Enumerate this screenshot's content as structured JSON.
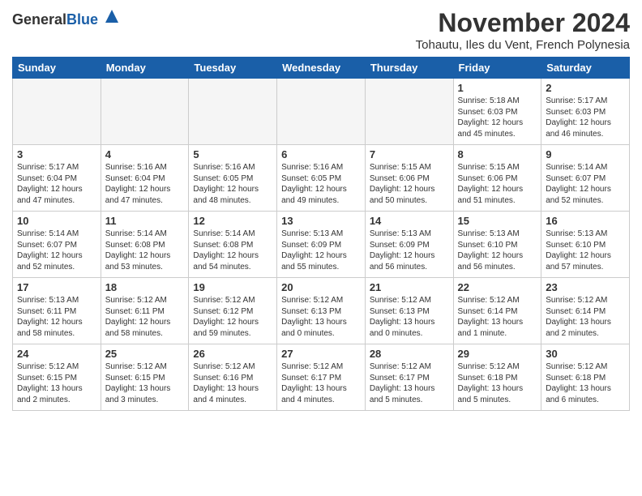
{
  "header": {
    "logo_general": "General",
    "logo_blue": "Blue",
    "month_title": "November 2024",
    "subtitle": "Tohautu, Iles du Vent, French Polynesia"
  },
  "columns": [
    "Sunday",
    "Monday",
    "Tuesday",
    "Wednesday",
    "Thursday",
    "Friday",
    "Saturday"
  ],
  "weeks": [
    [
      {
        "day": "",
        "info": "",
        "empty": true
      },
      {
        "day": "",
        "info": "",
        "empty": true
      },
      {
        "day": "",
        "info": "",
        "empty": true
      },
      {
        "day": "",
        "info": "",
        "empty": true
      },
      {
        "day": "",
        "info": "",
        "empty": true
      },
      {
        "day": "1",
        "info": "Sunrise: 5:18 AM\nSunset: 6:03 PM\nDaylight: 12 hours\nand 45 minutes.",
        "empty": false
      },
      {
        "day": "2",
        "info": "Sunrise: 5:17 AM\nSunset: 6:03 PM\nDaylight: 12 hours\nand 46 minutes.",
        "empty": false
      }
    ],
    [
      {
        "day": "3",
        "info": "Sunrise: 5:17 AM\nSunset: 6:04 PM\nDaylight: 12 hours\nand 47 minutes.",
        "empty": false
      },
      {
        "day": "4",
        "info": "Sunrise: 5:16 AM\nSunset: 6:04 PM\nDaylight: 12 hours\nand 47 minutes.",
        "empty": false
      },
      {
        "day": "5",
        "info": "Sunrise: 5:16 AM\nSunset: 6:05 PM\nDaylight: 12 hours\nand 48 minutes.",
        "empty": false
      },
      {
        "day": "6",
        "info": "Sunrise: 5:16 AM\nSunset: 6:05 PM\nDaylight: 12 hours\nand 49 minutes.",
        "empty": false
      },
      {
        "day": "7",
        "info": "Sunrise: 5:15 AM\nSunset: 6:06 PM\nDaylight: 12 hours\nand 50 minutes.",
        "empty": false
      },
      {
        "day": "8",
        "info": "Sunrise: 5:15 AM\nSunset: 6:06 PM\nDaylight: 12 hours\nand 51 minutes.",
        "empty": false
      },
      {
        "day": "9",
        "info": "Sunrise: 5:14 AM\nSunset: 6:07 PM\nDaylight: 12 hours\nand 52 minutes.",
        "empty": false
      }
    ],
    [
      {
        "day": "10",
        "info": "Sunrise: 5:14 AM\nSunset: 6:07 PM\nDaylight: 12 hours\nand 52 minutes.",
        "empty": false
      },
      {
        "day": "11",
        "info": "Sunrise: 5:14 AM\nSunset: 6:08 PM\nDaylight: 12 hours\nand 53 minutes.",
        "empty": false
      },
      {
        "day": "12",
        "info": "Sunrise: 5:14 AM\nSunset: 6:08 PM\nDaylight: 12 hours\nand 54 minutes.",
        "empty": false
      },
      {
        "day": "13",
        "info": "Sunrise: 5:13 AM\nSunset: 6:09 PM\nDaylight: 12 hours\nand 55 minutes.",
        "empty": false
      },
      {
        "day": "14",
        "info": "Sunrise: 5:13 AM\nSunset: 6:09 PM\nDaylight: 12 hours\nand 56 minutes.",
        "empty": false
      },
      {
        "day": "15",
        "info": "Sunrise: 5:13 AM\nSunset: 6:10 PM\nDaylight: 12 hours\nand 56 minutes.",
        "empty": false
      },
      {
        "day": "16",
        "info": "Sunrise: 5:13 AM\nSunset: 6:10 PM\nDaylight: 12 hours\nand 57 minutes.",
        "empty": false
      }
    ],
    [
      {
        "day": "17",
        "info": "Sunrise: 5:13 AM\nSunset: 6:11 PM\nDaylight: 12 hours\nand 58 minutes.",
        "empty": false
      },
      {
        "day": "18",
        "info": "Sunrise: 5:12 AM\nSunset: 6:11 PM\nDaylight: 12 hours\nand 58 minutes.",
        "empty": false
      },
      {
        "day": "19",
        "info": "Sunrise: 5:12 AM\nSunset: 6:12 PM\nDaylight: 12 hours\nand 59 minutes.",
        "empty": false
      },
      {
        "day": "20",
        "info": "Sunrise: 5:12 AM\nSunset: 6:13 PM\nDaylight: 13 hours\nand 0 minutes.",
        "empty": false
      },
      {
        "day": "21",
        "info": "Sunrise: 5:12 AM\nSunset: 6:13 PM\nDaylight: 13 hours\nand 0 minutes.",
        "empty": false
      },
      {
        "day": "22",
        "info": "Sunrise: 5:12 AM\nSunset: 6:14 PM\nDaylight: 13 hours\nand 1 minute.",
        "empty": false
      },
      {
        "day": "23",
        "info": "Sunrise: 5:12 AM\nSunset: 6:14 PM\nDaylight: 13 hours\nand 2 minutes.",
        "empty": false
      }
    ],
    [
      {
        "day": "24",
        "info": "Sunrise: 5:12 AM\nSunset: 6:15 PM\nDaylight: 13 hours\nand 2 minutes.",
        "empty": false
      },
      {
        "day": "25",
        "info": "Sunrise: 5:12 AM\nSunset: 6:15 PM\nDaylight: 13 hours\nand 3 minutes.",
        "empty": false
      },
      {
        "day": "26",
        "info": "Sunrise: 5:12 AM\nSunset: 6:16 PM\nDaylight: 13 hours\nand 4 minutes.",
        "empty": false
      },
      {
        "day": "27",
        "info": "Sunrise: 5:12 AM\nSunset: 6:17 PM\nDaylight: 13 hours\nand 4 minutes.",
        "empty": false
      },
      {
        "day": "28",
        "info": "Sunrise: 5:12 AM\nSunset: 6:17 PM\nDaylight: 13 hours\nand 5 minutes.",
        "empty": false
      },
      {
        "day": "29",
        "info": "Sunrise: 5:12 AM\nSunset: 6:18 PM\nDaylight: 13 hours\nand 5 minutes.",
        "empty": false
      },
      {
        "day": "30",
        "info": "Sunrise: 5:12 AM\nSunset: 6:18 PM\nDaylight: 13 hours\nand 6 minutes.",
        "empty": false
      }
    ]
  ]
}
